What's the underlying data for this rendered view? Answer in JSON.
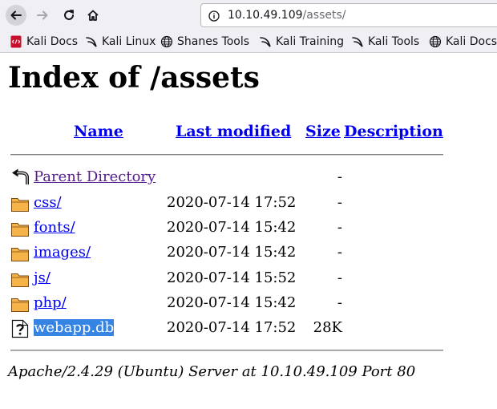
{
  "browser": {
    "url_host": "10.10.49.109",
    "url_path": "/assets/"
  },
  "bookmarks": [
    {
      "label": "Kali Docs",
      "icon": "kali-docs-icon"
    },
    {
      "label": "Kali Linux",
      "icon": "kali-dragon-icon"
    },
    {
      "label": "Shanes Tools",
      "icon": "globe-icon"
    },
    {
      "label": "Kali Training",
      "icon": "kali-dragon-icon"
    },
    {
      "label": "Kali Tools",
      "icon": "kali-dragon-icon"
    },
    {
      "label": "Kali Docs",
      "icon": "globe-icon"
    }
  ],
  "page": {
    "title": "Index of /assets",
    "columns": {
      "name": "Name",
      "last_modified": "Last modified",
      "size": "Size",
      "description": "Description"
    },
    "rows": [
      {
        "name": "Parent Directory",
        "modified": "",
        "size": "-",
        "icon": "parent-directory-icon"
      },
      {
        "name": "css/",
        "modified": "2020-07-14 17:52",
        "size": "-",
        "icon": "folder-icon"
      },
      {
        "name": "fonts/",
        "modified": "2020-07-14 15:42",
        "size": "-",
        "icon": "folder-icon"
      },
      {
        "name": "images/",
        "modified": "2020-07-14 15:42",
        "size": "-",
        "icon": "folder-icon"
      },
      {
        "name": "js/",
        "modified": "2020-07-14 15:52",
        "size": "-",
        "icon": "folder-icon"
      },
      {
        "name": "php/",
        "modified": "2020-07-14 15:42",
        "size": "-",
        "icon": "folder-icon"
      },
      {
        "name": "webapp.db",
        "modified": "2020-07-14 17:52",
        "size": "28K",
        "icon": "unknown-file-icon"
      }
    ],
    "footer": "Apache/2.4.29 (Ubuntu) Server at 10.10.49.109 Port 80"
  },
  "colors": {
    "link": "#0000ee",
    "visited": "#551a8b",
    "selection": "#3584e4",
    "folder": "#f0a030"
  }
}
